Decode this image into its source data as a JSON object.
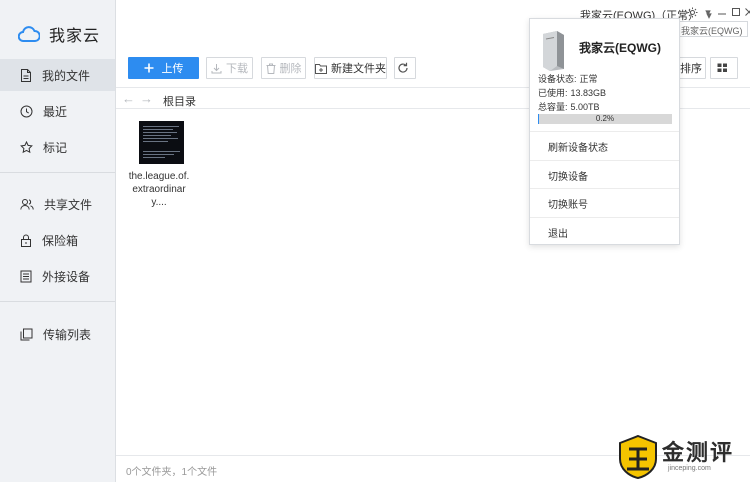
{
  "app": {
    "name": "我家云"
  },
  "titlebar": {
    "device_label": "我家云(EQWG)（正常）",
    "dropdown_caret": "▾",
    "settings_icon": "gear-icon",
    "minimize_icon": "minimize-icon",
    "maximize_icon": "maximize-icon",
    "close_icon": "close-icon"
  },
  "sidebar": {
    "items": [
      {
        "label": "我的文件",
        "icon": "file-icon",
        "active": true
      },
      {
        "label": "最近",
        "icon": "clock-icon"
      },
      {
        "label": "标记",
        "icon": "star-icon"
      },
      {
        "label": "共享文件",
        "icon": "users-icon"
      },
      {
        "label": "保险箱",
        "icon": "lock-icon"
      },
      {
        "label": "外接设备",
        "icon": "device-list-icon"
      },
      {
        "label": "传输列表",
        "icon": "transfer-list-icon"
      }
    ]
  },
  "toolbar": {
    "upload": "上传",
    "download": "下载",
    "delete": "删除",
    "new_folder": "新建文件夹",
    "sort": "排序"
  },
  "path": {
    "current": "根目录"
  },
  "files": [
    {
      "name": "the.league.of.extraordinary...."
    }
  ],
  "status": {
    "summary": "0个文件夹，1个文件"
  },
  "device_menu": {
    "name": "我家云(EQWG)",
    "status_label": "设备状态:",
    "status_value": "正常",
    "used_label": "已使用:",
    "used_value": "13.83GB",
    "total_label": "总容量:",
    "total_value": "5.00TB",
    "usage_percent_text": "0.2%",
    "usage_fraction": 0.002,
    "items": [
      "刷新设备状态",
      "切换设备",
      "切换账号",
      "退出"
    ]
  },
  "watermark": {
    "text": "金测评",
    "sub": "jinceping.com"
  },
  "colors": {
    "accent": "#2d8cf0",
    "sidebar_bg": "#f0f2f5"
  }
}
